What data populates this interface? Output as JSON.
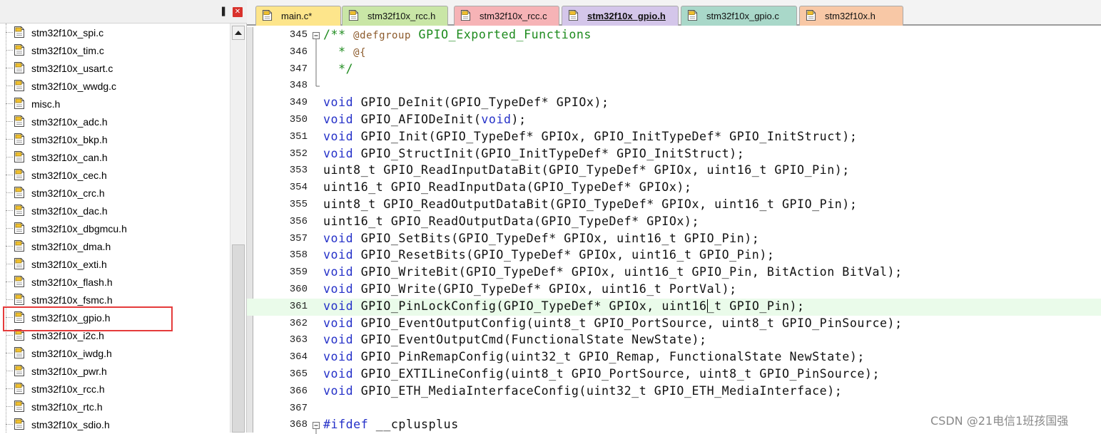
{
  "panel": {
    "pin_glyph": "▐",
    "close_glyph": "✕",
    "files": [
      "stm32f10x_spi.c",
      "stm32f10x_tim.c",
      "stm32f10x_usart.c",
      "stm32f10x_wwdg.c",
      "misc.h",
      "stm32f10x_adc.h",
      "stm32f10x_bkp.h",
      "stm32f10x_can.h",
      "stm32f10x_cec.h",
      "stm32f10x_crc.h",
      "stm32f10x_dac.h",
      "stm32f10x_dbgmcu.h",
      "stm32f10x_dma.h",
      "stm32f10x_exti.h",
      "stm32f10x_flash.h",
      "stm32f10x_fsmc.h",
      "stm32f10x_gpio.h",
      "stm32f10x_i2c.h",
      "stm32f10x_iwdg.h",
      "stm32f10x_pwr.h",
      "stm32f10x_rcc.h",
      "stm32f10x_rtc.h",
      "stm32f10x_sdio.h"
    ],
    "highlighted_file": "stm32f10x_gpio.h"
  },
  "tabs": [
    {
      "label": "main.c*",
      "color": "#fde58b",
      "active": false
    },
    {
      "label": "stm32f10x_rcc.h",
      "color": "#c9e6a6",
      "active": false
    },
    {
      "label": "stm32f10x_rcc.c",
      "color": "#f6b3b6",
      "active": false
    },
    {
      "label": "stm32f10x_gpio.h",
      "color": "#d4c6ea",
      "active": true
    },
    {
      "label": "stm32f10x_gpio.c",
      "color": "#a9d8c9",
      "active": false
    },
    {
      "label": "stm32f10x.h",
      "color": "#f8c8a6",
      "active": false
    }
  ],
  "code": {
    "current_line": "361",
    "lines": [
      {
        "n": "345",
        "fold": "minus",
        "parts": [
          [
            "cm",
            "/** "
          ],
          [
            "cmk",
            "@defgroup"
          ],
          [
            "cm",
            " GPIO_Exported_Functions"
          ]
        ]
      },
      {
        "n": "346",
        "fold": "bar",
        "parts": [
          [
            "cm",
            "  * "
          ],
          [
            "cmk",
            "@{"
          ]
        ]
      },
      {
        "n": "347",
        "fold": "bar",
        "parts": [
          [
            "cm",
            "  */"
          ]
        ]
      },
      {
        "n": "348",
        "fold": "end",
        "parts": []
      },
      {
        "n": "349",
        "fold": "",
        "parts": [
          [
            "kw",
            "void"
          ],
          [
            "",
            " GPIO_DeInit(GPIO_TypeDef* GPIOx);"
          ]
        ]
      },
      {
        "n": "350",
        "fold": "",
        "parts": [
          [
            "kw",
            "void"
          ],
          [
            "",
            " GPIO_AFIODeInit("
          ],
          [
            "kw",
            "void"
          ],
          [
            "",
            ");"
          ]
        ]
      },
      {
        "n": "351",
        "fold": "",
        "parts": [
          [
            "kw",
            "void"
          ],
          [
            "",
            " GPIO_Init(GPIO_TypeDef* GPIOx, GPIO_InitTypeDef* GPIO_InitStruct);"
          ]
        ]
      },
      {
        "n": "352",
        "fold": "",
        "parts": [
          [
            "kw",
            "void"
          ],
          [
            "",
            " GPIO_StructInit(GPIO_InitTypeDef* GPIO_InitStruct);"
          ]
        ]
      },
      {
        "n": "353",
        "fold": "",
        "parts": [
          [
            "",
            "uint8_t GPIO_ReadInputDataBit(GPIO_TypeDef* GPIOx, uint16_t GPIO_Pin);"
          ]
        ]
      },
      {
        "n": "354",
        "fold": "",
        "parts": [
          [
            "",
            "uint16_t GPIO_ReadInputData(GPIO_TypeDef* GPIOx);"
          ]
        ]
      },
      {
        "n": "355",
        "fold": "",
        "parts": [
          [
            "",
            "uint8_t GPIO_ReadOutputDataBit(GPIO_TypeDef* GPIOx, uint16_t GPIO_Pin);"
          ]
        ]
      },
      {
        "n": "356",
        "fold": "",
        "parts": [
          [
            "",
            "uint16_t GPIO_ReadOutputData(GPIO_TypeDef* GPIOx);"
          ]
        ]
      },
      {
        "n": "357",
        "fold": "",
        "parts": [
          [
            "kw",
            "void"
          ],
          [
            "",
            " GPIO_SetBits(GPIO_TypeDef* GPIOx, uint16_t GPIO_Pin);"
          ]
        ]
      },
      {
        "n": "358",
        "fold": "",
        "parts": [
          [
            "kw",
            "void"
          ],
          [
            "",
            " GPIO_ResetBits(GPIO_TypeDef* GPIOx, uint16_t GPIO_Pin);"
          ]
        ]
      },
      {
        "n": "359",
        "fold": "",
        "parts": [
          [
            "kw",
            "void"
          ],
          [
            "",
            " GPIO_WriteBit(GPIO_TypeDef* GPIOx, uint16_t GPIO_Pin, BitAction BitVal);"
          ]
        ]
      },
      {
        "n": "360",
        "fold": "",
        "parts": [
          [
            "kw",
            "void"
          ],
          [
            "",
            " GPIO_Write(GPIO_TypeDef* GPIOx, uint16_t PortVal);"
          ]
        ]
      },
      {
        "n": "361",
        "fold": "",
        "parts": [
          [
            "kw",
            "void"
          ],
          [
            "",
            " GPIO_PinLockConfig(GPIO_TypeDef* GPIOx, uint16"
          ],
          [
            "cursor",
            ""
          ],
          [
            "",
            "_t GPIO_Pin);"
          ]
        ]
      },
      {
        "n": "362",
        "fold": "",
        "parts": [
          [
            "kw",
            "void"
          ],
          [
            "",
            " GPIO_EventOutputConfig(uint8_t GPIO_PortSource, uint8_t GPIO_PinSource);"
          ]
        ]
      },
      {
        "n": "363",
        "fold": "",
        "parts": [
          [
            "kw",
            "void"
          ],
          [
            "",
            " GPIO_EventOutputCmd(FunctionalState NewState);"
          ]
        ]
      },
      {
        "n": "364",
        "fold": "",
        "parts": [
          [
            "kw",
            "void"
          ],
          [
            "",
            " GPIO_PinRemapConfig(uint32_t GPIO_Remap, FunctionalState NewState);"
          ]
        ]
      },
      {
        "n": "365",
        "fold": "",
        "parts": [
          [
            "kw",
            "void"
          ],
          [
            "",
            " GPIO_EXTILineConfig(uint8_t GPIO_PortSource, uint8_t GPIO_PinSource);"
          ]
        ]
      },
      {
        "n": "366",
        "fold": "",
        "parts": [
          [
            "kw",
            "void"
          ],
          [
            "",
            " GPIO_ETH_MediaInterfaceConfig(uint32_t GPIO_ETH_MediaInterface);"
          ]
        ]
      },
      {
        "n": "367",
        "fold": "",
        "parts": []
      },
      {
        "n": "368",
        "fold": "minus",
        "parts": [
          [
            "kw",
            "#ifdef"
          ],
          [
            "",
            " __cplusplus"
          ]
        ]
      }
    ]
  },
  "watermark": "CSDN @21电信1班孩国强"
}
